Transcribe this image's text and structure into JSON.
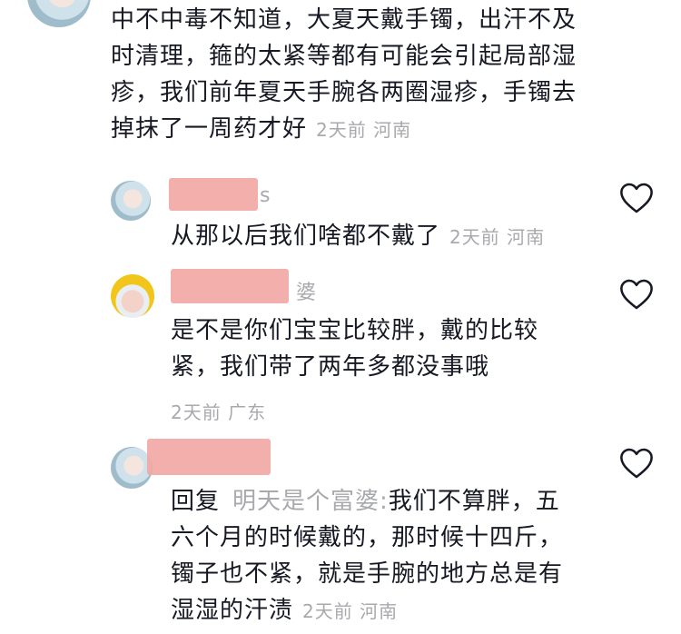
{
  "comment_main": {
    "text": "中不中毒不知道，大夏天戴手镯，出汗不及时清理，箍的太紧等都有可能会引起局部湿疹，我们前年夏天手腕各两圈湿疹，手镯去掉抹了一周药才好",
    "line1": "中不中毒不知道，大夏天戴手镯，出汗不及",
    "line2": "时清理，箍的太紧等都有可能会引起局部湿",
    "line3": "疹，我们前年夏天手腕各两圈湿疹，手镯去",
    "line4": "掉抹了一周药才好",
    "time": "2天前",
    "location": "河南"
  },
  "reply1": {
    "name_tail": "s",
    "text": "从那以后我们啥都不戴了",
    "time": "2天前",
    "location": "河南"
  },
  "reply2": {
    "name_tail": "婆",
    "line1": "是不是你们宝宝比较胖，戴的比较",
    "line2": "紧，我们带了两年多都没事哦",
    "time": "2天前",
    "location": "广东"
  },
  "reply3": {
    "reply_prefix": "回复",
    "reply_to": "明天是个富婆:",
    "line1_rest": "我们不算胖，五",
    "line2": "六个月的时候戴的，那时候十四斤，",
    "line3": "镯子也不紧，就是手腕的地方总是有",
    "line4": "湿湿的汗渍",
    "time": "2天前",
    "location": "河南"
  },
  "icons": {
    "like": "heart-outline-icon",
    "like_color": "#161823"
  }
}
